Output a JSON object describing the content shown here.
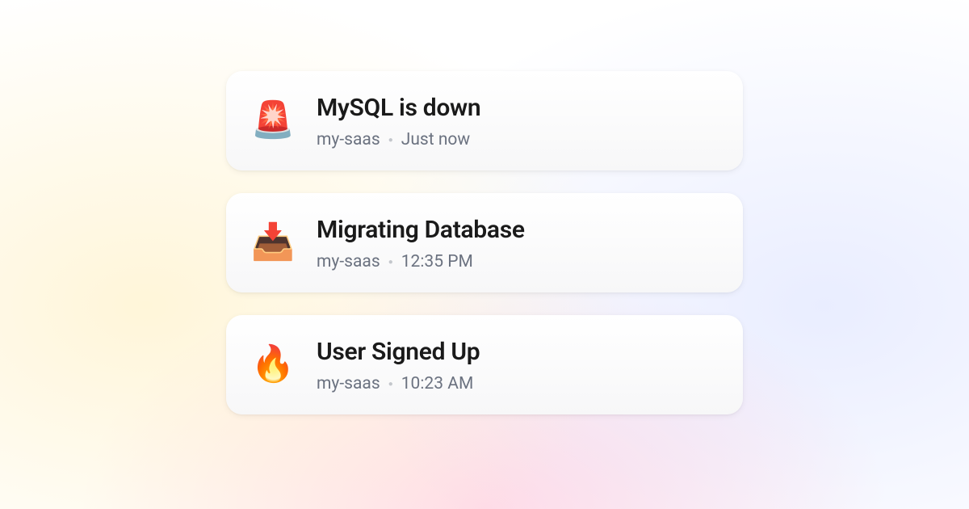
{
  "notifications": [
    {
      "icon": "🚨",
      "icon_name": "siren-icon",
      "title": "MySQL is down",
      "source": "my-saas",
      "timestamp": "Just now"
    },
    {
      "icon": "📥",
      "icon_name": "inbox-download-icon",
      "title": "Migrating Database",
      "source": "my-saas",
      "timestamp": "12:35 PM"
    },
    {
      "icon": "🔥",
      "icon_name": "fire-icon",
      "title": "User Signed Up",
      "source": "my-saas",
      "timestamp": "10:23 AM"
    }
  ]
}
